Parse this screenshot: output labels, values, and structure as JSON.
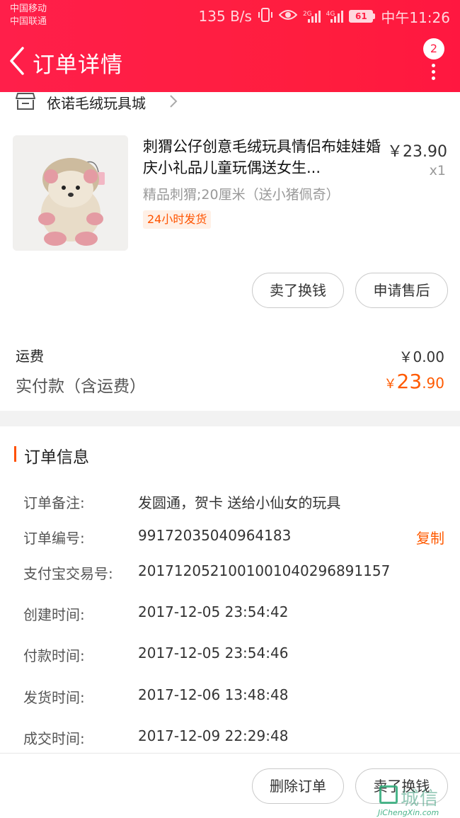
{
  "status_bar": {
    "carrier_1": "中国移动",
    "carrier_2": "中国联通",
    "net_speed": "135 B/s",
    "net_4g": "4G",
    "net_2g": "2G",
    "battery": "61",
    "time": "中午11:26"
  },
  "nav": {
    "title": "订单详情",
    "badge_count": "2"
  },
  "shop": {
    "name": "依诺毛绒玩具城"
  },
  "product": {
    "title": "刺猬公仔创意毛绒玩具情侣布娃娃婚庆小礼品儿童玩偶送女生...",
    "price": "￥23.90",
    "quantity": "x1",
    "sku": "精品刺猬;20厘米（送小猪佩奇）",
    "tag": "24小时发货",
    "buttons": [
      "卖了换钱",
      "申请售后"
    ]
  },
  "payment": {
    "shipping_label": "运费",
    "shipping_value": "￥0.00",
    "paid_label": "实付款（含运费）",
    "paid_currency": "￥",
    "paid_integer": "23",
    "paid_decimal": ".90"
  },
  "order_info": {
    "section_title": "订单信息",
    "copy_label": "复制",
    "rows": [
      {
        "label": "订单备注:",
        "value": "发圆通，贺卡  送给小仙女的玩具"
      },
      {
        "label": "订单编号:",
        "value": "99172035040964183"
      },
      {
        "label": "支付宝交易号:",
        "value": "2017120521001001040296891157"
      },
      {
        "label": "创建时间:",
        "value": "2017-12-05 23:54:42"
      },
      {
        "label": "付款时间:",
        "value": "2017-12-05 23:54:46"
      },
      {
        "label": "发货时间:",
        "value": "2017-12-06 13:48:48"
      },
      {
        "label": "成交时间:",
        "value": "2017-12-09 22:29:48"
      }
    ]
  },
  "bottom_bar": {
    "buttons": [
      "删除订单",
      "卖了换钱"
    ]
  },
  "watermark": {
    "cn": "城信",
    "en": "JiChengXin.com"
  },
  "colors": {
    "header": "#ff1f4a",
    "accent": "#ff5a00"
  }
}
